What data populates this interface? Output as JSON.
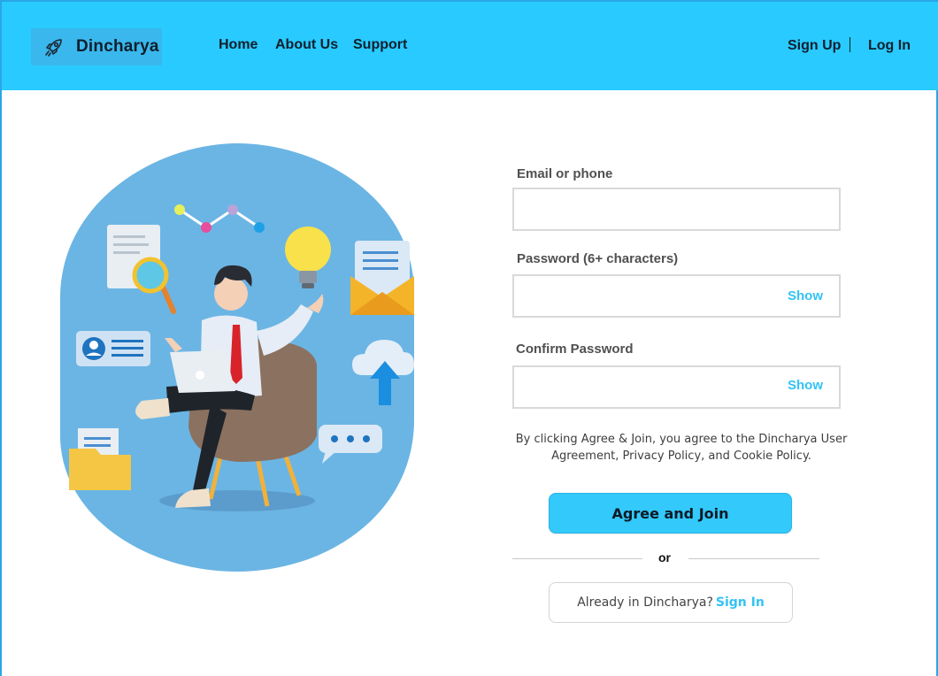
{
  "header": {
    "brand_name": "Dincharya",
    "nav": {
      "home": "Home",
      "about": "About Us",
      "support": "Support"
    },
    "auth": {
      "signup": "Sign Up",
      "login": "Log In"
    }
  },
  "form": {
    "email": {
      "label": "Email or phone",
      "value": ""
    },
    "password": {
      "label": "Password (6+ characters)",
      "value": "",
      "show_label": "Show"
    },
    "confirm": {
      "label": "Confirm Password",
      "value": "",
      "show_label": "Show"
    },
    "terms": "By clicking Agree & Join, you agree to the Dincharya User Agreement, Privacy Policy, and Cookie Policy.",
    "join_button": "Agree and Join",
    "divider": "or",
    "already_text": "Already in Dincharya?",
    "signin_link": "Sign In"
  },
  "colors": {
    "header_bg": "#29caff",
    "accent": "#33c3f5",
    "illustration_bg": "#6bb5e4"
  },
  "icons": {
    "brand": "rocket-icon"
  }
}
